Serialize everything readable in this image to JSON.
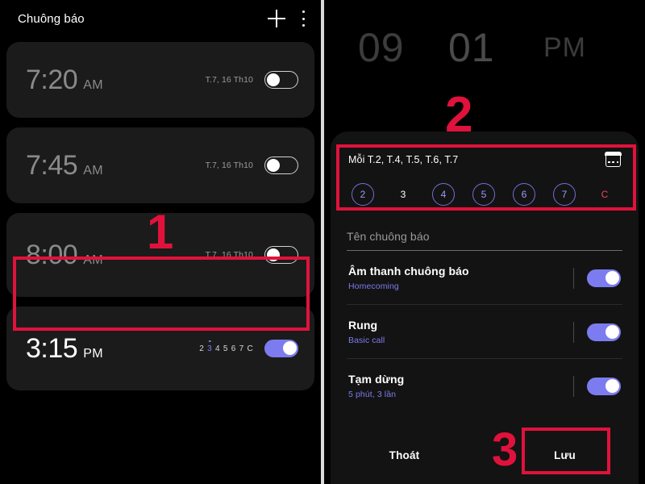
{
  "left_panel": {
    "header": {
      "title": "Chuông báo",
      "add_icon": "plus-icon",
      "menu_icon": "kebab-menu-icon"
    },
    "alarms": [
      {
        "time": "7:20",
        "ampm": "AM",
        "days_text": "T.7, 16 Th10",
        "enabled": false
      },
      {
        "time": "7:45",
        "ampm": "AM",
        "days_text": "T.7, 16 Th10",
        "enabled": false
      },
      {
        "time": "8:00",
        "ampm": "AM",
        "days_text": "T.7, 16 Th10",
        "enabled": false,
        "highlighted": true
      },
      {
        "time": "3:15",
        "ampm": "PM",
        "enabled": true,
        "day_numbers": [
          "2",
          "3",
          "4",
          "5",
          "6",
          "7",
          "C"
        ],
        "active_day_index": 1
      }
    ]
  },
  "right_panel": {
    "time_picker": {
      "hour": "09",
      "minute": "01",
      "ampm": "PM"
    },
    "repeat": {
      "label": "Mỗi T.2, T.4, T.5, T.6, T.7",
      "calendar_icon": "calendar-icon",
      "days": [
        {
          "label": "2",
          "selected": true,
          "sunday": false
        },
        {
          "label": "3",
          "selected": false,
          "sunday": false
        },
        {
          "label": "4",
          "selected": true,
          "sunday": false
        },
        {
          "label": "5",
          "selected": true,
          "sunday": false
        },
        {
          "label": "6",
          "selected": true,
          "sunday": false
        },
        {
          "label": "7",
          "selected": true,
          "sunday": false
        },
        {
          "label": "C",
          "selected": false,
          "sunday": true
        }
      ]
    },
    "name_field": {
      "placeholder": "Tên chuông báo",
      "value": ""
    },
    "settings": [
      {
        "title": "Âm thanh chuông báo",
        "sub": "Homecoming",
        "enabled": true
      },
      {
        "title": "Rung",
        "sub": "Basic call",
        "enabled": true
      },
      {
        "title": "Tạm dừng",
        "sub": "5 phút, 3 lần",
        "enabled": true
      }
    ],
    "buttons": {
      "cancel": "Thoát",
      "save": "Lưu"
    }
  },
  "annotations": {
    "step1": "1",
    "step2": "2",
    "step3": "3"
  },
  "colors": {
    "accent_purple": "#7c7cf0",
    "annotation_red": "#e0123c",
    "sunday_red": "#e8475f",
    "card_bg": "#1b1b1b",
    "sheet_bg": "#131313"
  }
}
